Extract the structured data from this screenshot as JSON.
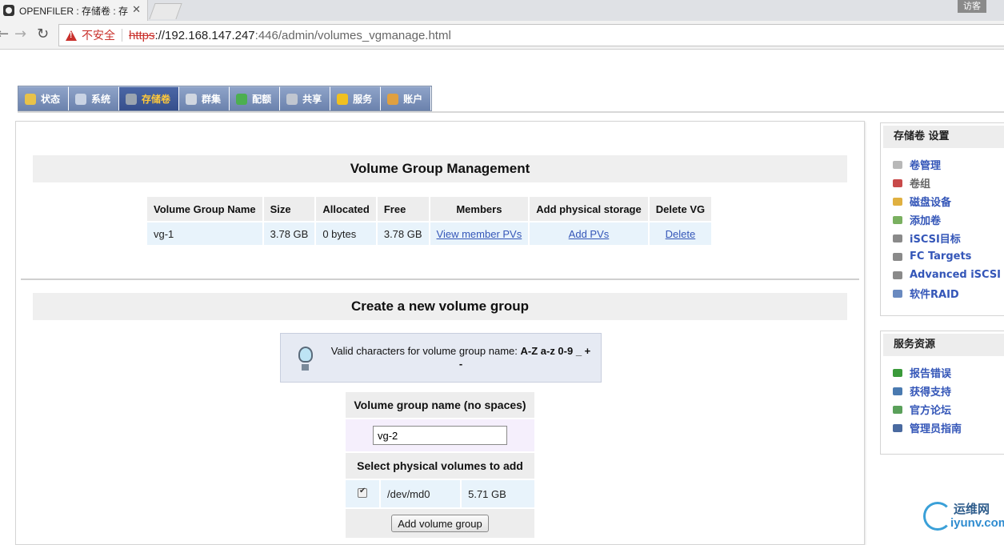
{
  "browser": {
    "tab_title": "OPENFILER : 存储卷 : 存",
    "tab_close": "✕",
    "guest_label": "访客",
    "nav_back": "←",
    "nav_forward": "→",
    "nav_reload": "↻",
    "security_label": "不安全",
    "url_scheme": "https",
    "url_host": "://192.168.147.247",
    "url_rest": ":446/admin/volumes_vgmanage.html"
  },
  "main_nav": {
    "active": "存储卷",
    "tabs": [
      {
        "label": "状态",
        "icon": "status-icon",
        "color": "#e8c24a"
      },
      {
        "label": "系统",
        "icon": "system-icon",
        "color": "#c9d3e4"
      },
      {
        "label": "存储卷",
        "icon": "volumes-icon",
        "color": "#9aa4b0"
      },
      {
        "label": "群集",
        "icon": "cluster-icon",
        "color": "#d0d6e0"
      },
      {
        "label": "配额",
        "icon": "quota-icon",
        "color": "#4caf50"
      },
      {
        "label": "共享",
        "icon": "shares-icon",
        "color": "#c0c6d0"
      },
      {
        "label": "服务",
        "icon": "services-icon",
        "color": "#f0c020"
      },
      {
        "label": "账户",
        "icon": "accounts-icon",
        "color": "#e0a040"
      }
    ]
  },
  "vg_management": {
    "title": "Volume Group Management",
    "columns": [
      "Volume Group Name",
      "Size",
      "Allocated",
      "Free",
      "Members",
      "Add physical storage",
      "Delete VG"
    ],
    "rows": [
      {
        "name": "vg-1",
        "size": "3.78 GB",
        "allocated": "0 bytes",
        "free": "3.78 GB",
        "members": "View member PVs",
        "add": "Add PVs",
        "delete": "Delete"
      }
    ]
  },
  "create_vg": {
    "title": "Create a new volume group",
    "hint_prefix": "Valid characters for volume group name: ",
    "hint_chars": "A-Z a-z 0-9 _ + -",
    "name_header": "Volume group name (no spaces)",
    "name_value": "vg-2",
    "pv_header": "Select physical volumes to add",
    "pvs": [
      {
        "device": "/dev/md0",
        "size": "5.71 GB",
        "checked": true
      }
    ],
    "submit_label": "Add volume group"
  },
  "sidebar": {
    "storage_title": "存储卷 设置",
    "storage_items": [
      {
        "label": "卷管理",
        "icon": "volume-mgmt-icon",
        "color": "#b8b8b8",
        "current": false
      },
      {
        "label": "卷组",
        "icon": "volume-group-icon",
        "color": "#c84a4a",
        "current": true
      },
      {
        "label": "磁盘设备",
        "icon": "disk-icon",
        "color": "#e0b040",
        "current": false
      },
      {
        "label": "添加卷",
        "icon": "add-volume-icon",
        "color": "#7ab060",
        "current": false
      },
      {
        "label": "iSCSI目标",
        "icon": "iscsi-target-icon",
        "color": "#8a8a8a",
        "current": false
      },
      {
        "label": "FC Targets",
        "icon": "fc-targets-icon",
        "color": "#8a8a8a",
        "current": false
      },
      {
        "label": "Advanced iSCSI",
        "icon": "advanced-iscsi-icon",
        "color": "#8a8a8a",
        "current": false
      },
      {
        "label": "软件RAID",
        "icon": "raid-icon",
        "color": "#6a8ac0",
        "current": false
      }
    ],
    "resources_title": "服务资源",
    "resource_items": [
      {
        "label": "报告错误",
        "icon": "bug-icon",
        "color": "#3a9a3a"
      },
      {
        "label": "获得支持",
        "icon": "support-icon",
        "color": "#4a7ab0"
      },
      {
        "label": "官方论坛",
        "icon": "forum-icon",
        "color": "#5aa05a"
      },
      {
        "label": "管理员指南",
        "icon": "guide-icon",
        "color": "#4a6aa0"
      }
    ]
  },
  "watermark": {
    "cn": "运维网",
    "en": "iyunv.com"
  }
}
